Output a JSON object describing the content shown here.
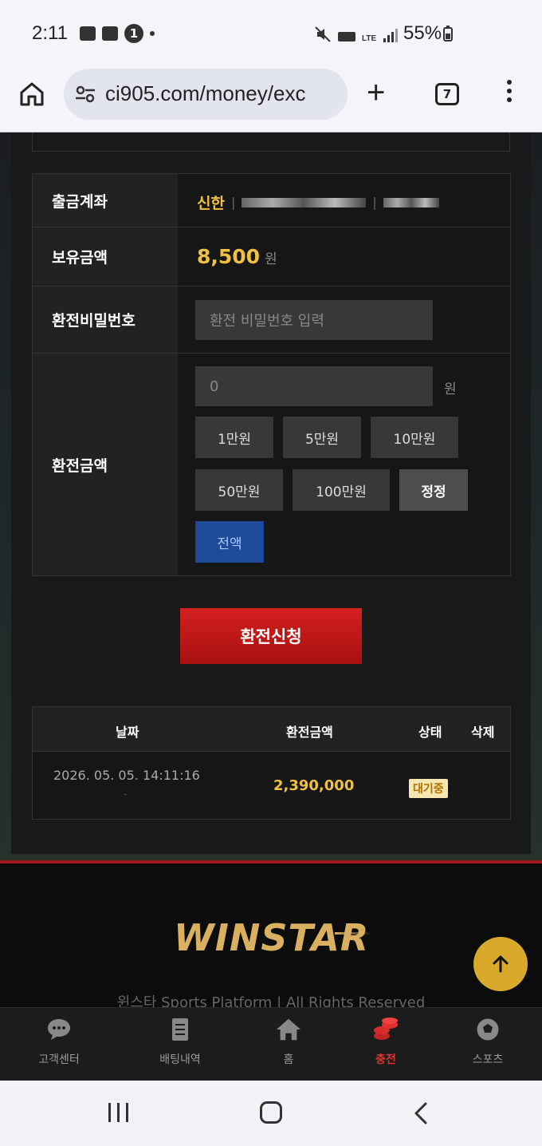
{
  "status_bar": {
    "time": "2:11",
    "notification_count": "1",
    "network": "LTE",
    "battery": "55%"
  },
  "browser": {
    "url": "ci905.com/money/exc",
    "tab_count": "7"
  },
  "form": {
    "account_label": "출금계좌",
    "bank": "신한",
    "balance_label": "보유금액",
    "balance_amount": "8,500",
    "balance_unit": "원",
    "password_label": "환전비밀번호",
    "password_placeholder": "환전 비밀번호 입력",
    "amount_label": "환전금액",
    "amount_value": "0",
    "amount_unit": "원",
    "quick_amounts": [
      "1만원",
      "5만원",
      "10만원",
      "50만원",
      "100만원"
    ],
    "reset_label": "정정",
    "all_label": "전액"
  },
  "submit_label": "환전신청",
  "history": {
    "columns": [
      "날짜",
      "환전금액",
      "상태",
      "삭제"
    ],
    "rows": [
      {
        "date": "2026. 05. 05. 14:11:16",
        "sub": "-",
        "amount": "2,390,000",
        "status": "대기중"
      }
    ]
  },
  "footer": {
    "logo": "WINSTAR",
    "copyright": "윈스타 Sports Platform | All Rights Reserved"
  },
  "bottom_nav": [
    {
      "label": "고객센터",
      "icon": "chat-icon"
    },
    {
      "label": "배팅내역",
      "icon": "receipt-icon"
    },
    {
      "label": "홈",
      "icon": "home-icon"
    },
    {
      "label": "충전",
      "icon": "coins-icon",
      "active": true
    },
    {
      "label": "스포츠",
      "icon": "soccer-ball-icon"
    }
  ],
  "colors": {
    "accent_gold": "#f0c040",
    "accent_red": "#d42020",
    "all_blue": "#1f4a9a"
  }
}
